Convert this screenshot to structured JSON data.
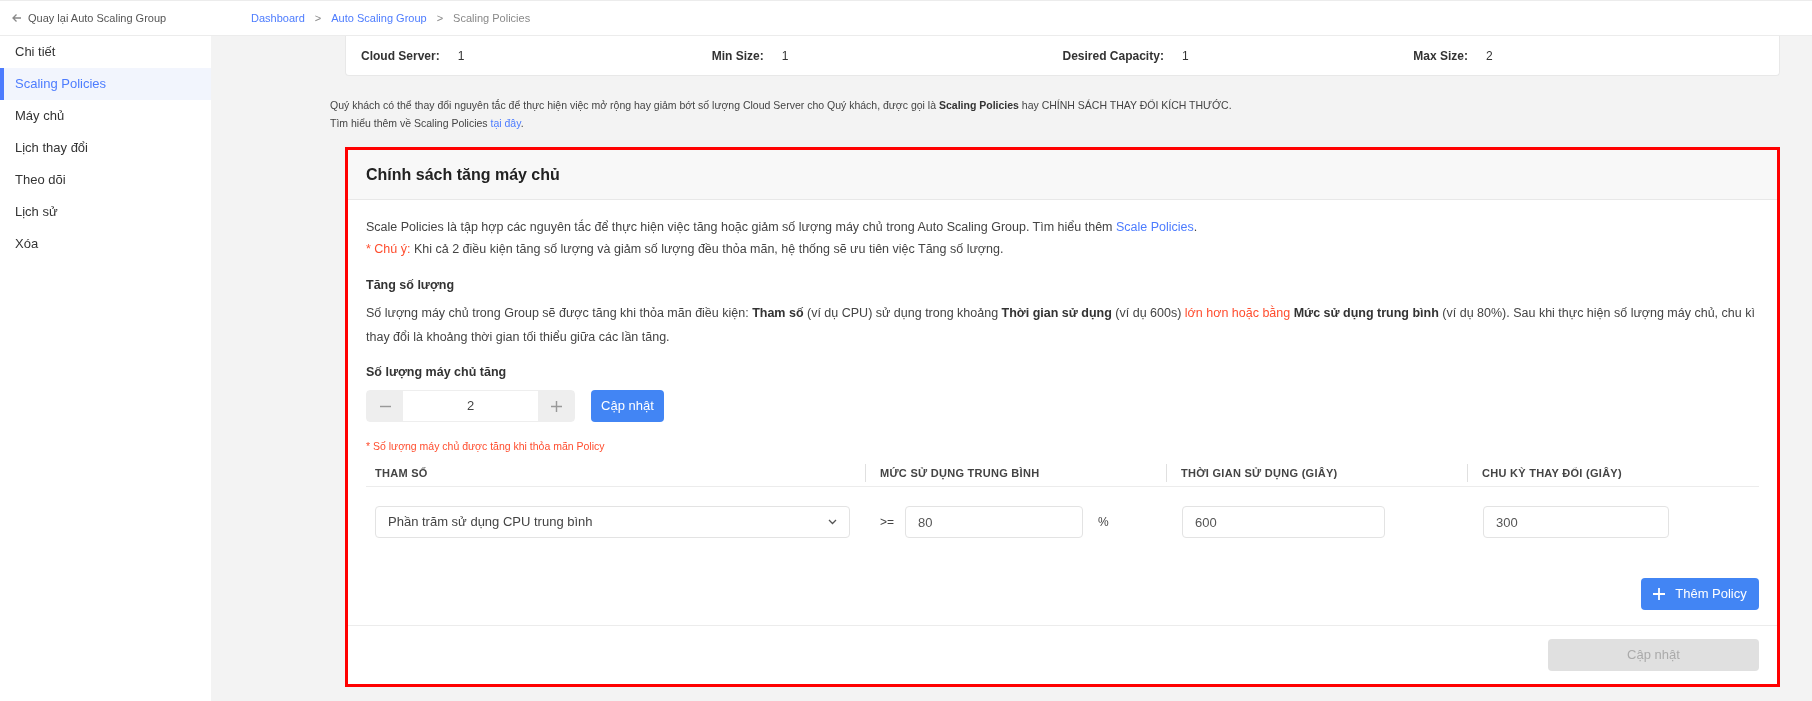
{
  "back_link": "Quay lại Auto Scaling Group",
  "breadcrumb_separator": ">",
  "breadcrumb": [
    {
      "label": "Dashboard",
      "kind": "link"
    },
    {
      "label": "Auto Scaling Group",
      "kind": "link"
    },
    {
      "label": "Scaling Policies",
      "kind": "current"
    }
  ],
  "sidebar": {
    "items": [
      {
        "label": "Chi tiết",
        "selected": false
      },
      {
        "label": "Scaling Policies",
        "selected": true
      },
      {
        "label": "Máy chủ",
        "selected": false
      },
      {
        "label": "Lịch thay đổi",
        "selected": false
      },
      {
        "label": "Theo dõi",
        "selected": false
      },
      {
        "label": "Lịch sử",
        "selected": false
      },
      {
        "label": "Xóa",
        "selected": false
      }
    ]
  },
  "stats": [
    {
      "label": "Cloud Server:",
      "value": "1"
    },
    {
      "label": "Min Size:",
      "value": "1"
    },
    {
      "label": "Desired Capacity:",
      "value": "1"
    },
    {
      "label": "Max Size:",
      "value": "2"
    }
  ],
  "intro": [
    [
      {
        "kind": "plain",
        "text": "Quý khách có thể thay đổi nguyên tắc để thực hiện việc mở rộng hay giảm bớt số lượng Cloud Server cho Quý khách, được gọi là "
      },
      {
        "kind": "bold",
        "text": "Scaling Policies"
      },
      {
        "kind": "plain",
        "text": " hay CHÍNH SÁCH THAY ĐỔI KÍCH THƯỚC."
      }
    ],
    [
      {
        "kind": "plain",
        "text": "Tìm hiểu thêm về Scaling Policies "
      },
      {
        "kind": "link",
        "text": "tại đây"
      },
      {
        "kind": "plain",
        "text": "."
      }
    ]
  ],
  "panel": {
    "title": "Chính sách tăng máy chủ",
    "highlighted": true,
    "description": [
      [
        {
          "kind": "plain",
          "text": "Scale Policies là tập hợp các nguyên tắc để thực hiện việc tăng hoặc giảm số lượng máy chủ trong Auto Scaling Group. Tìm hiểu thêm "
        },
        {
          "kind": "link",
          "text": "Scale Policies"
        },
        {
          "kind": "plain",
          "text": "."
        }
      ],
      [
        {
          "kind": "alert",
          "text": "* Chú ý:"
        },
        {
          "kind": "plain",
          "text": " Khi cả 2 điều kiện tăng số lượng và giảm số lượng đều thỏa mãn, hệ thống sẽ ưu tiên việc Tăng số lượng."
        }
      ]
    ],
    "section_title": "Tăng số lượng",
    "section_text": [
      {
        "kind": "plain",
        "text": "Số lượng máy chủ trong Group sẽ được tăng khi thỏa mãn điều kiện: "
      },
      {
        "kind": "bold",
        "text": "Tham số"
      },
      {
        "kind": "plain",
        "text": " (ví dụ CPU) sử dụng trong khoảng "
      },
      {
        "kind": "bold",
        "text": "Thời gian sử dụng"
      },
      {
        "kind": "plain",
        "text": " (ví dụ 600s) "
      },
      {
        "kind": "alert",
        "text": "lớn hơn hoặc bằng"
      },
      {
        "kind": "bold",
        "text": " Mức sử dụng trung bình"
      },
      {
        "kind": "plain",
        "text": " (ví dụ 80%). Sau khi thực hiện số lượng máy chủ, chu kì thay đổi là khoảng thời gian tối thiểu giữa các lần tăng."
      }
    ],
    "stepper": {
      "label": "Số lượng máy chủ tăng",
      "value": "2",
      "button": "Cập nhật",
      "note": "* Số lượng máy chủ được tăng khi thỏa mãn Policy"
    },
    "table": {
      "columns": [
        "THAM SỐ",
        "MỨC SỬ DỤNG TRUNG BÌNH",
        "THỜI GIAN SỬ DỤNG (GIÂY)",
        "CHU KỲ THAY ĐỔI (GIÂY)"
      ],
      "rows": [
        {
          "parameter": "Phần trăm sử dụng CPU trung bình",
          "operator": ">=",
          "threshold": "80",
          "unit": "%",
          "duration": "600",
          "cooldown": "300"
        }
      ]
    },
    "add_button": "Thêm Policy",
    "submit": {
      "label": "Cập nhật",
      "disabled": true
    }
  }
}
